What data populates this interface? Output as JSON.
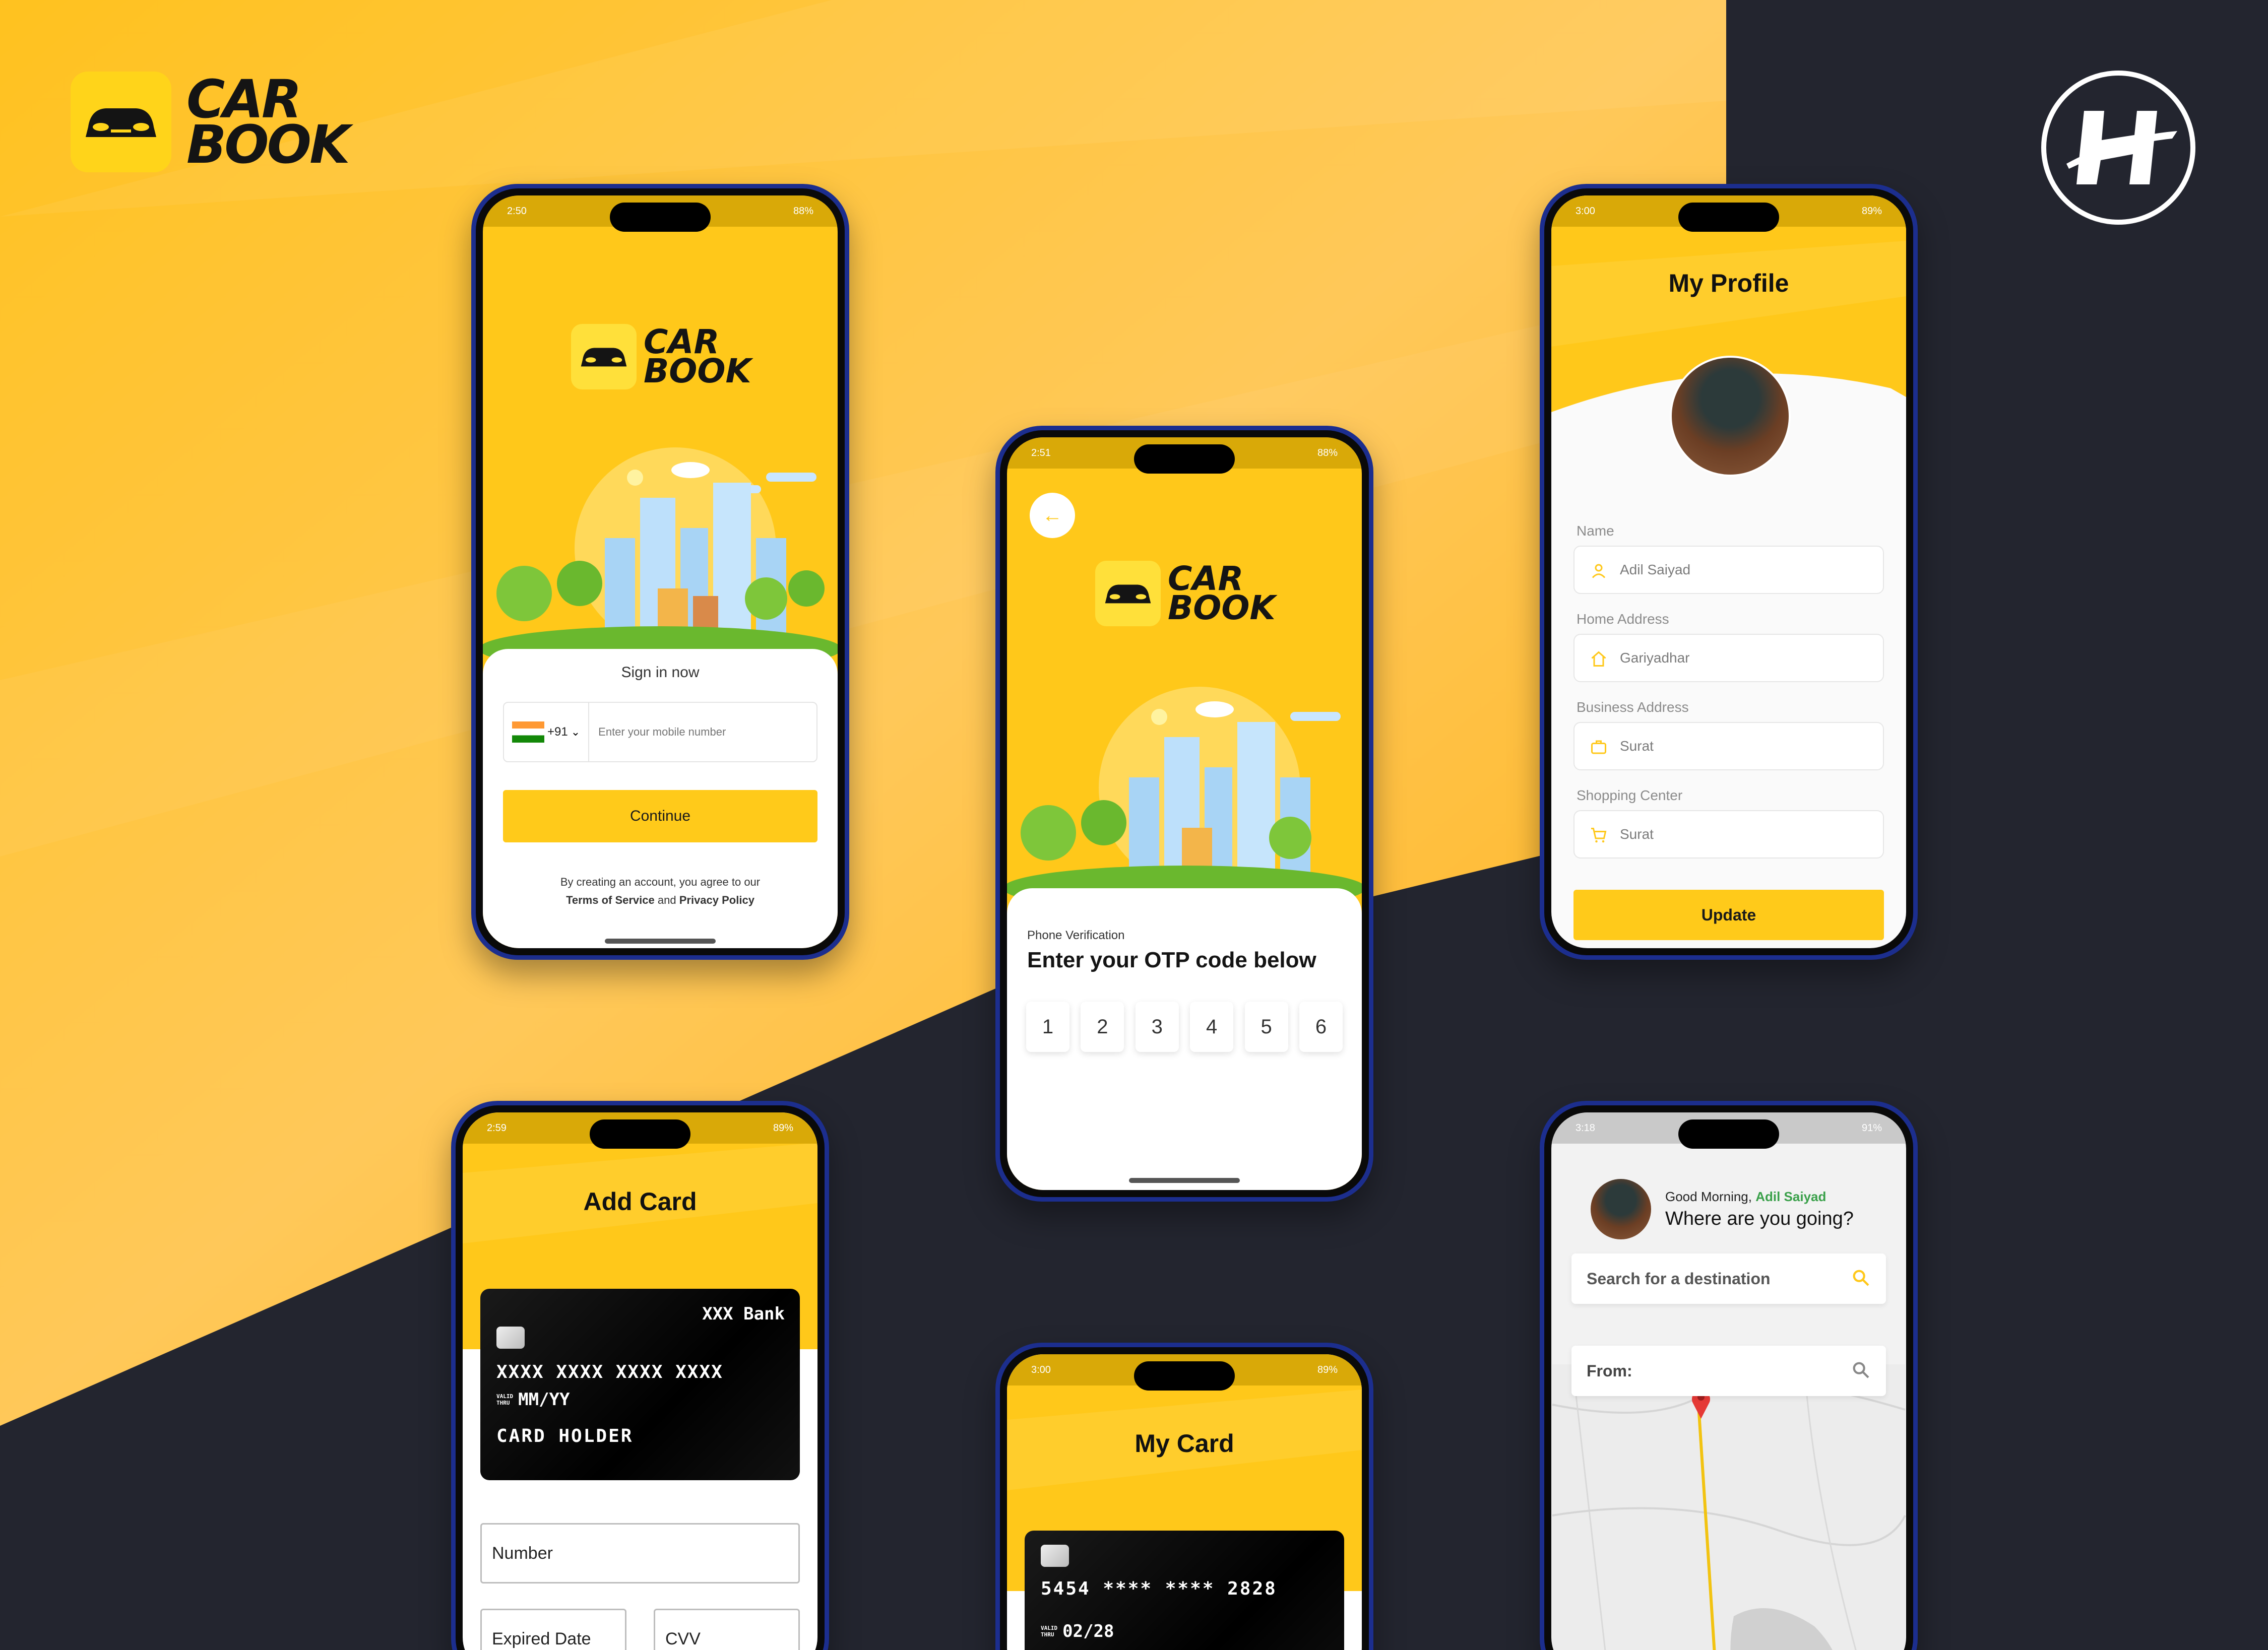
{
  "brand": {
    "line1": "CAR",
    "line2": "BOOK"
  },
  "colors": {
    "accent": "#FFC81A",
    "dark_bg": "#23252F",
    "frame": "#1C2E8E"
  },
  "screens": {
    "signin": {
      "time": "2:50",
      "battery": "88%",
      "logo_line1": "CAR",
      "logo_line2": "BOOK",
      "heading": "Sign in now",
      "country_code": "+91",
      "phone_placeholder": "Enter your mobile number",
      "continue_label": "Continue",
      "terms_prefix": "By creating an account, you agree to our",
      "terms_link": "Terms of Service",
      "terms_and": "and",
      "privacy_link": "Privacy Policy"
    },
    "otp": {
      "time": "2:51",
      "battery": "88%",
      "logo_line1": "CAR",
      "logo_line2": "BOOK",
      "subheading": "Phone Verification",
      "heading": "Enter your OTP code below",
      "digits": [
        "1",
        "2",
        "3",
        "4",
        "5",
        "6"
      ]
    },
    "profile": {
      "time": "3:00",
      "battery": "89%",
      "title": "My Profile",
      "fields": [
        {
          "label": "Name",
          "value": "Adil Saiyad",
          "icon": "user-icon"
        },
        {
          "label": "Home Address",
          "value": "Gariyadhar",
          "icon": "home-icon"
        },
        {
          "label": "Business Address",
          "value": "Surat",
          "icon": "briefcase-icon"
        },
        {
          "label": "Shopping Center",
          "value": "Surat",
          "icon": "cart-icon"
        }
      ],
      "update_label": "Update"
    },
    "add_card": {
      "time": "2:59",
      "battery": "89%",
      "title": "Add Card",
      "bank": "XXX Bank",
      "number": "XXXX XXXX XXXX XXXX",
      "valid_label_1": "VALID",
      "valid_label_2": "THRU",
      "expiry": "MM/YY",
      "holder": "CARD HOLDER",
      "number_field": "Number",
      "expiry_field": "Expired Date",
      "cvv_field": "CVV"
    },
    "my_card": {
      "time": "3:00",
      "battery": "89%",
      "title": "My Card",
      "number": "5454 **** **** 2828",
      "valid_label_1": "VALID",
      "valid_label_2": "THRU",
      "expiry": "02/28"
    },
    "map": {
      "time": "3:18",
      "battery": "91%",
      "greeting": "Good Morning,",
      "user_name": "Adil Saiyad",
      "question": "Where are you going?",
      "search_placeholder": "Search for a destination",
      "from_label": "From:"
    }
  }
}
